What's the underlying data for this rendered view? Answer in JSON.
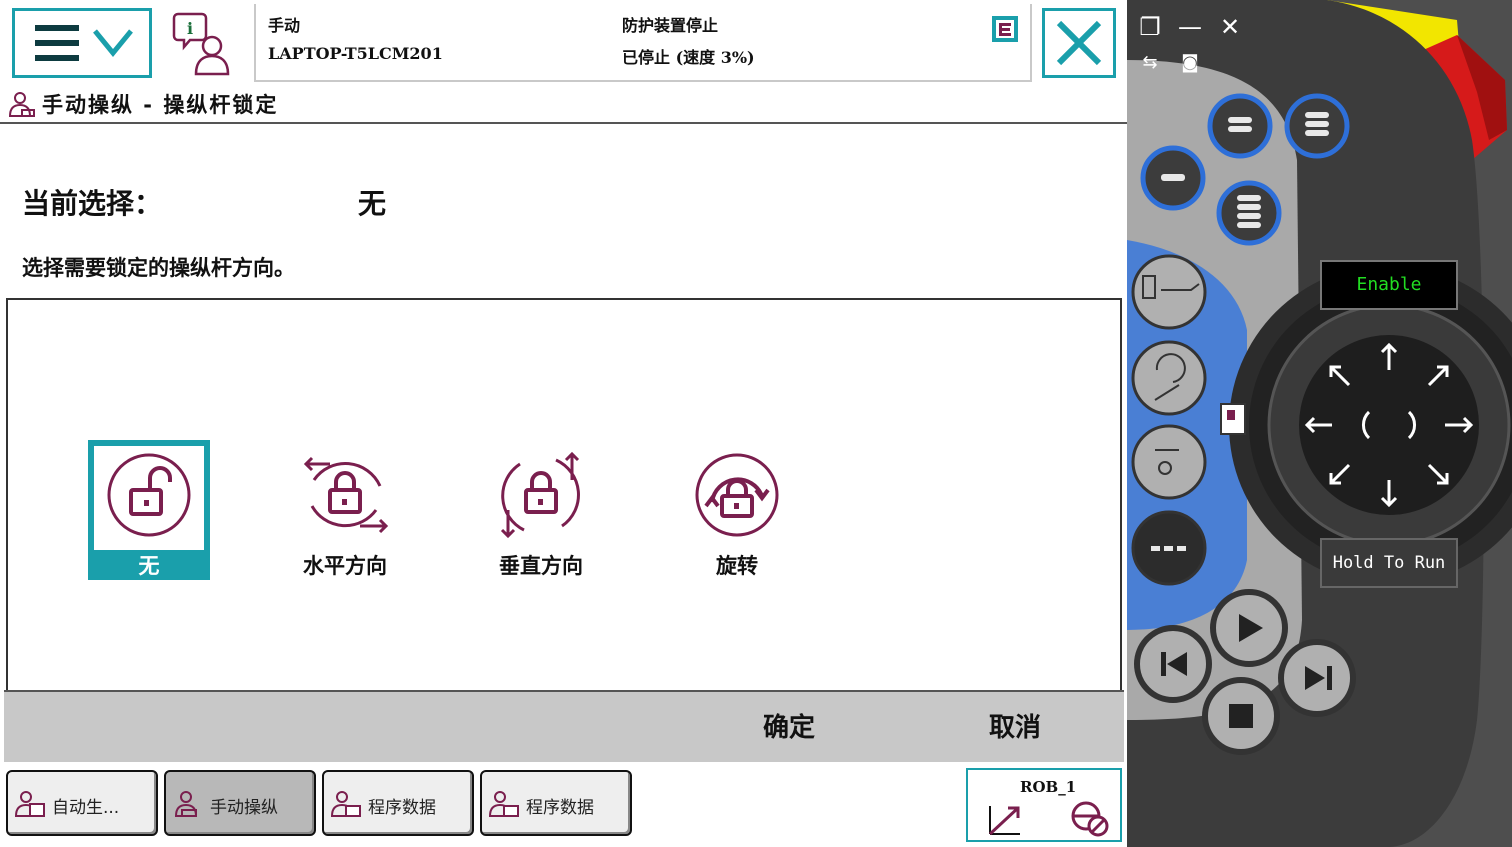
{
  "topbar": {
    "mode": "手动",
    "host": "LAPTOP-T5LCM201",
    "guard_status": "防护装置停止",
    "run_status": "已停止 (速度 3%)"
  },
  "title": {
    "text": "手动操纵 - 操纵杆锁定"
  },
  "main": {
    "current_label": "当前选择：",
    "current_value": "无",
    "instruction": "选择需要锁定的操纵杆方向。"
  },
  "options": [
    {
      "label": "无",
      "icon": "unlock-icon",
      "selected": true
    },
    {
      "label": "水平方向",
      "icon": "lock-horizontal-icon",
      "selected": false
    },
    {
      "label": "垂直方向",
      "icon": "lock-vertical-icon",
      "selected": false
    },
    {
      "label": "旋转",
      "icon": "lock-rotate-icon",
      "selected": false
    }
  ],
  "actions": {
    "ok": "确定",
    "cancel": "取消"
  },
  "taskbar": {
    "items": [
      {
        "label": "自动生...",
        "active": false
      },
      {
        "label": "手动操纵",
        "active": true
      },
      {
        "label": "程序数据",
        "active": false
      },
      {
        "label": "程序数据",
        "active": false
      }
    ],
    "rob": "ROB_1"
  },
  "pendant": {
    "enable": "Enable",
    "hold_to_run": "Hold To Run"
  },
  "colors": {
    "accent": "#1a9fab",
    "icon_maroon": "#7a1f4e",
    "pendant_blue": "#4a7fd4",
    "pendant_yellow": "#f2e600",
    "estop_red": "#d61a1a"
  }
}
